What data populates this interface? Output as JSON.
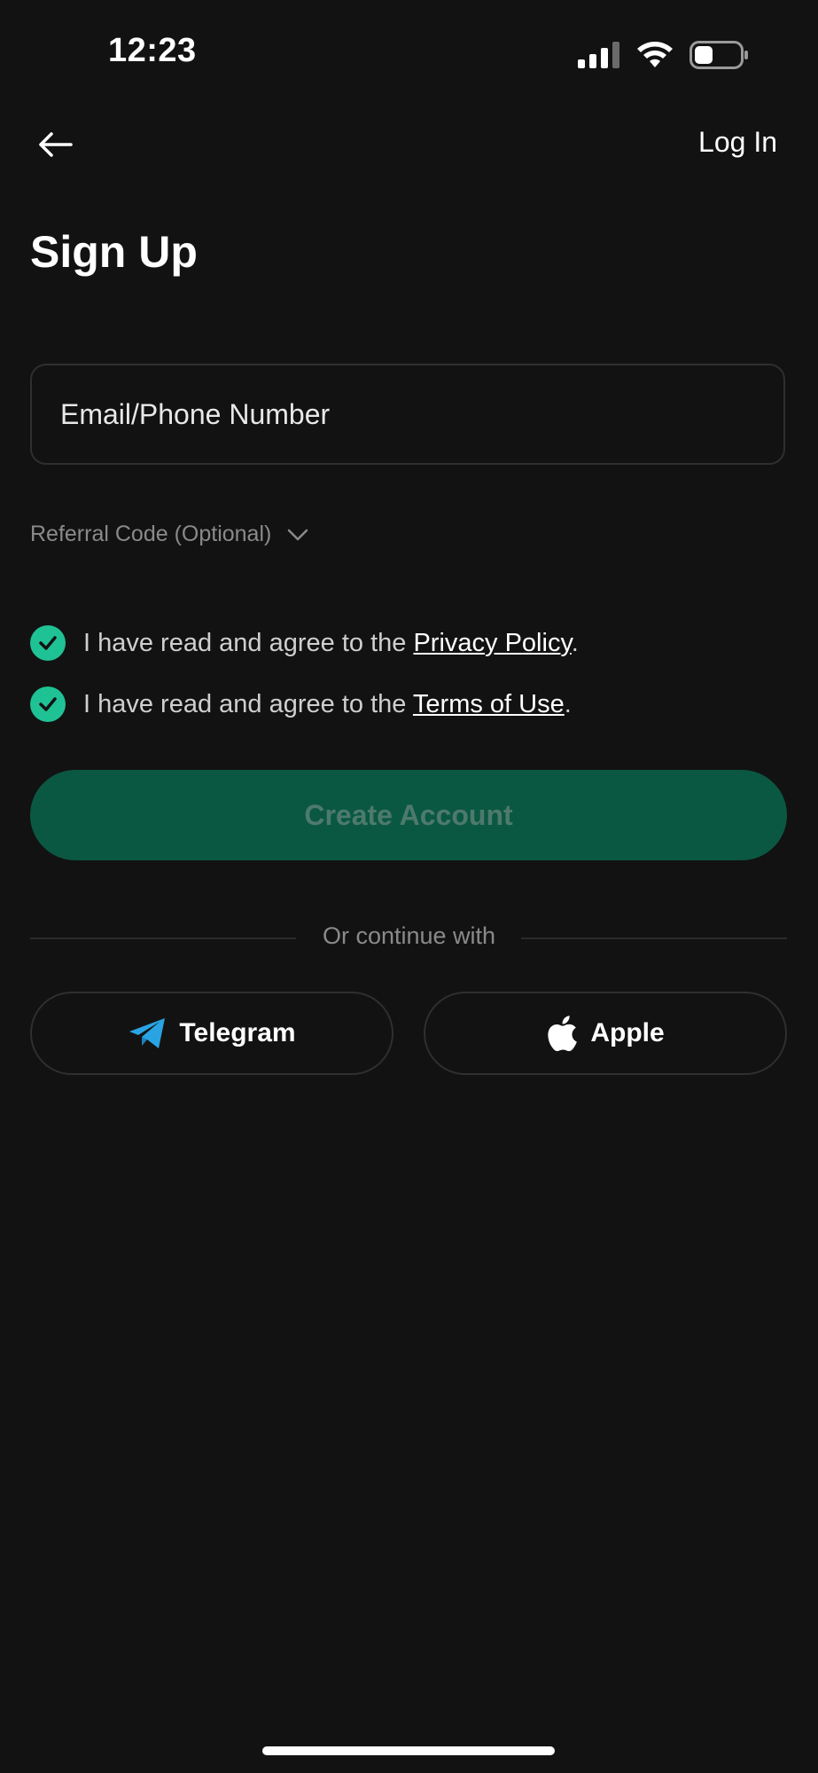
{
  "status_bar": {
    "time": "12:23",
    "icons": [
      "signal-icon",
      "wifi-icon",
      "battery-icon"
    ]
  },
  "nav": {
    "back_icon": "arrow-left-icon",
    "login_label": "Log In"
  },
  "page": {
    "title": "Sign Up"
  },
  "form": {
    "email_placeholder": "Email/Phone Number",
    "email_value": "",
    "referral_label": "Referral Code (Optional)",
    "agreements": [
      {
        "prefix": "I have read and agree to the ",
        "link": "Privacy Policy",
        "suffix": ".",
        "checked": true
      },
      {
        "prefix": "I have read and agree to the ",
        "link": "Terms of Use",
        "suffix": ".",
        "checked": true
      }
    ],
    "create_button_label": "Create Account"
  },
  "social": {
    "divider_text": "Or continue with",
    "telegram_label": "Telegram",
    "apple_label": "Apple"
  },
  "colors": {
    "background": "#121212",
    "accent": "#1fc295",
    "button_bg": "#0b5842",
    "telegram": "#2aa3e3"
  }
}
